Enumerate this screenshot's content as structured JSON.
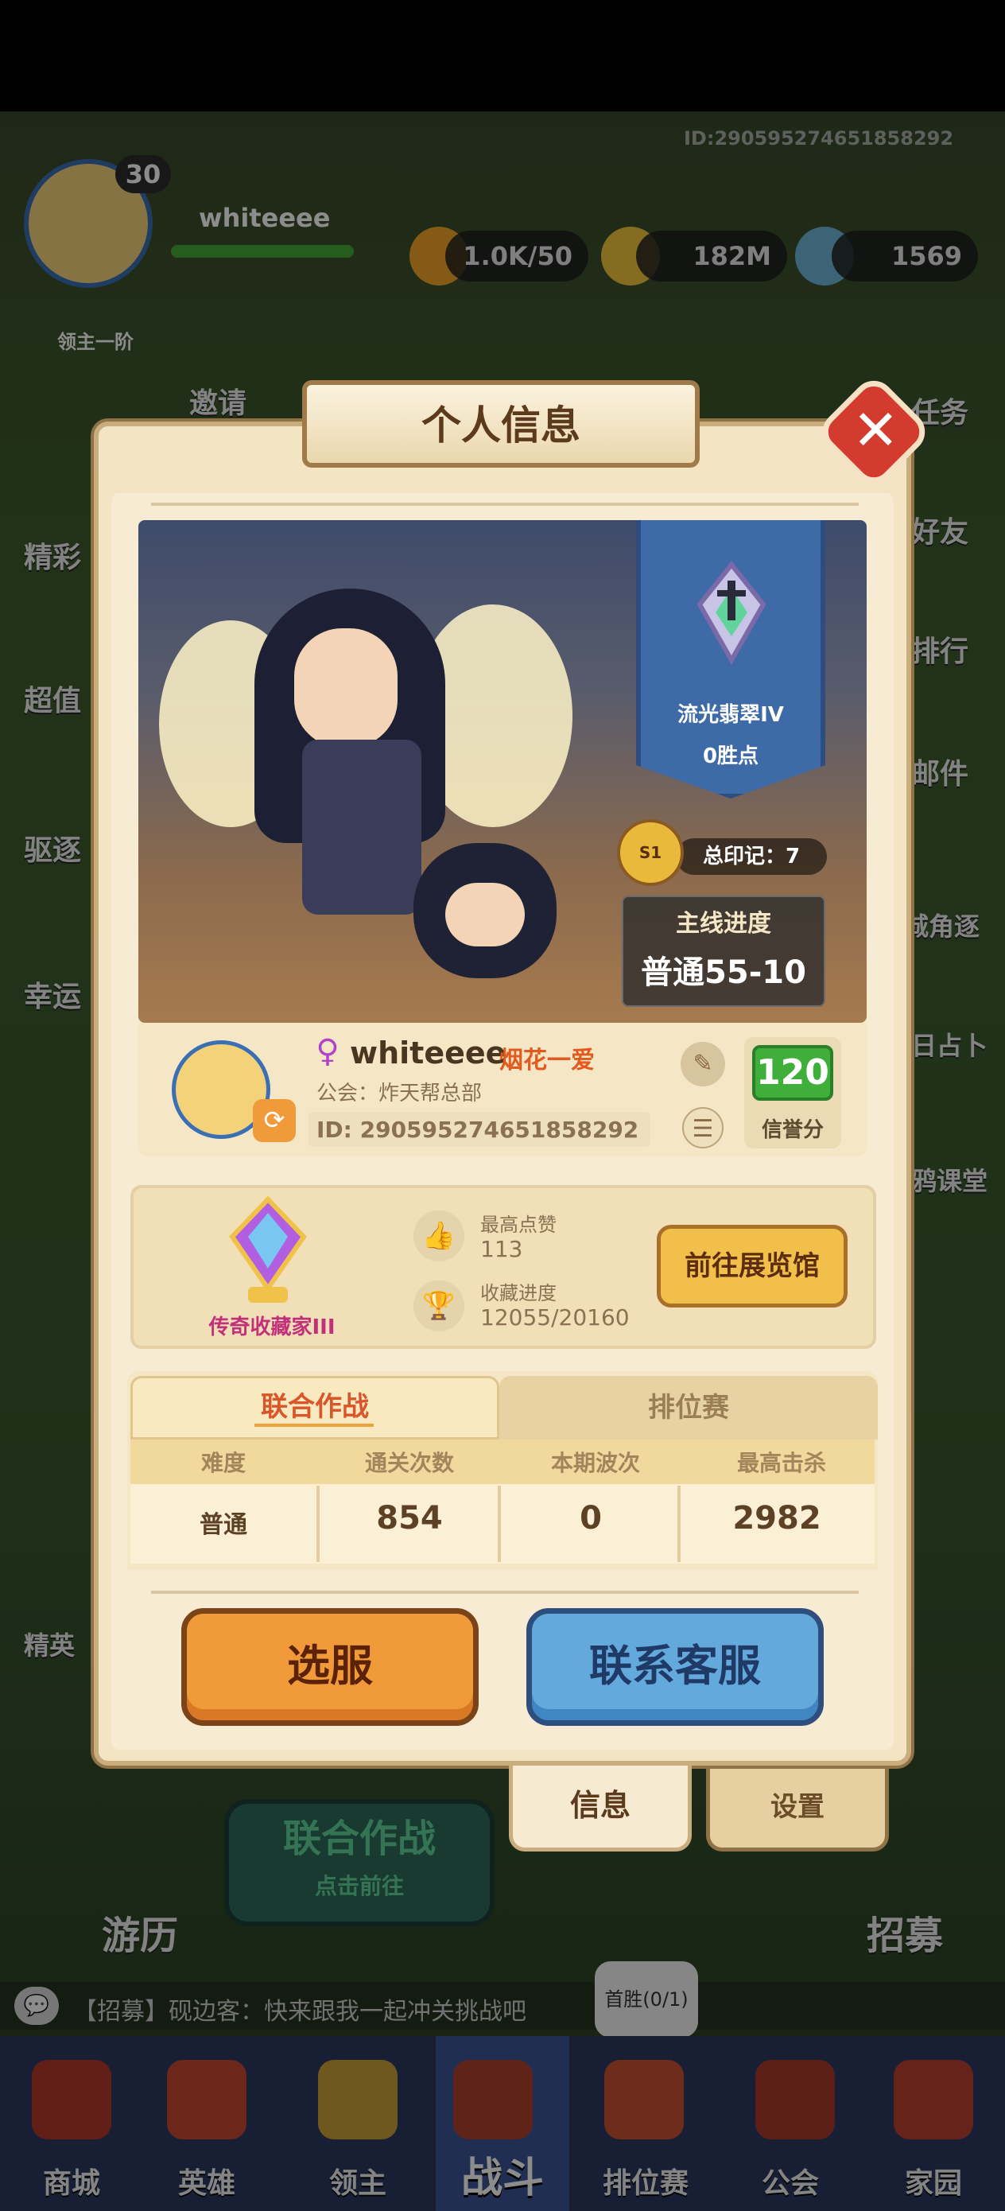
{
  "top": {
    "uid": "ID:290595274651858292",
    "player_level": "30",
    "player_name": "whiteeee",
    "lord_rank": "领主一阶",
    "resources": [
      {
        "name": "stamina",
        "value": "1.0K/50",
        "icon": "flame-icon"
      },
      {
        "name": "gold",
        "value": "182M",
        "icon": "coin-icon"
      },
      {
        "name": "gems",
        "value": "1569",
        "icon": "crystal-icon"
      }
    ]
  },
  "side_menu": {
    "left": [
      "精彩",
      "超值",
      "驱逐",
      "幸运"
    ],
    "right": [
      "任务",
      "好友",
      "排行",
      "邮件",
      "城角逐",
      "日占卜",
      "鸦课堂"
    ],
    "top_row": [
      "邀请"
    ]
  },
  "panel": {
    "title": "个人信息",
    "close_symbol": "✕"
  },
  "scene": {
    "rank_name": "流光翡翠IV",
    "rank_points": "0胜点",
    "seal_badge": "S1",
    "seal_text": "总印记：7",
    "progress_title": "主线进度",
    "progress_value": "普通55-10"
  },
  "player": {
    "name": "whiteeee",
    "gender_symbol": "♀",
    "title_tag": "烟花一爱",
    "guild": "公会：炸天帮总部",
    "id": "ID: 290595274651858292",
    "credit_value": "120",
    "credit_label": "信誉分"
  },
  "collection": {
    "title": "传奇收藏家III",
    "likes_label": "最高点赞",
    "likes_value": "113",
    "progress_label": "收藏进度",
    "progress_value": "12055/20160",
    "gallery_button": "前往展览馆"
  },
  "tabs": {
    "active": "联合作战",
    "inactive": "排位赛"
  },
  "table": {
    "headers": [
      "难度",
      "通关次数",
      "本期波次",
      "最高击杀"
    ],
    "row": [
      "普通",
      "854",
      "0",
      "2982"
    ]
  },
  "buttons": {
    "select_server": "选服",
    "contact_service": "联系客服"
  },
  "panel_tabs": {
    "info": "信息",
    "settings": "设置"
  },
  "background": {
    "battle_title": "联合作战",
    "battle_sub": "点击前往",
    "travel": "游历",
    "recruit": "招募",
    "elite": "精英"
  },
  "chat": {
    "message": "【招募】砚边客：快来跟我一起冲关挑战吧",
    "first_win": "首胜(0/1)"
  },
  "nav": {
    "items": [
      "商城",
      "英雄",
      "领主",
      "战斗",
      "排位赛",
      "公会",
      "家园"
    ]
  }
}
